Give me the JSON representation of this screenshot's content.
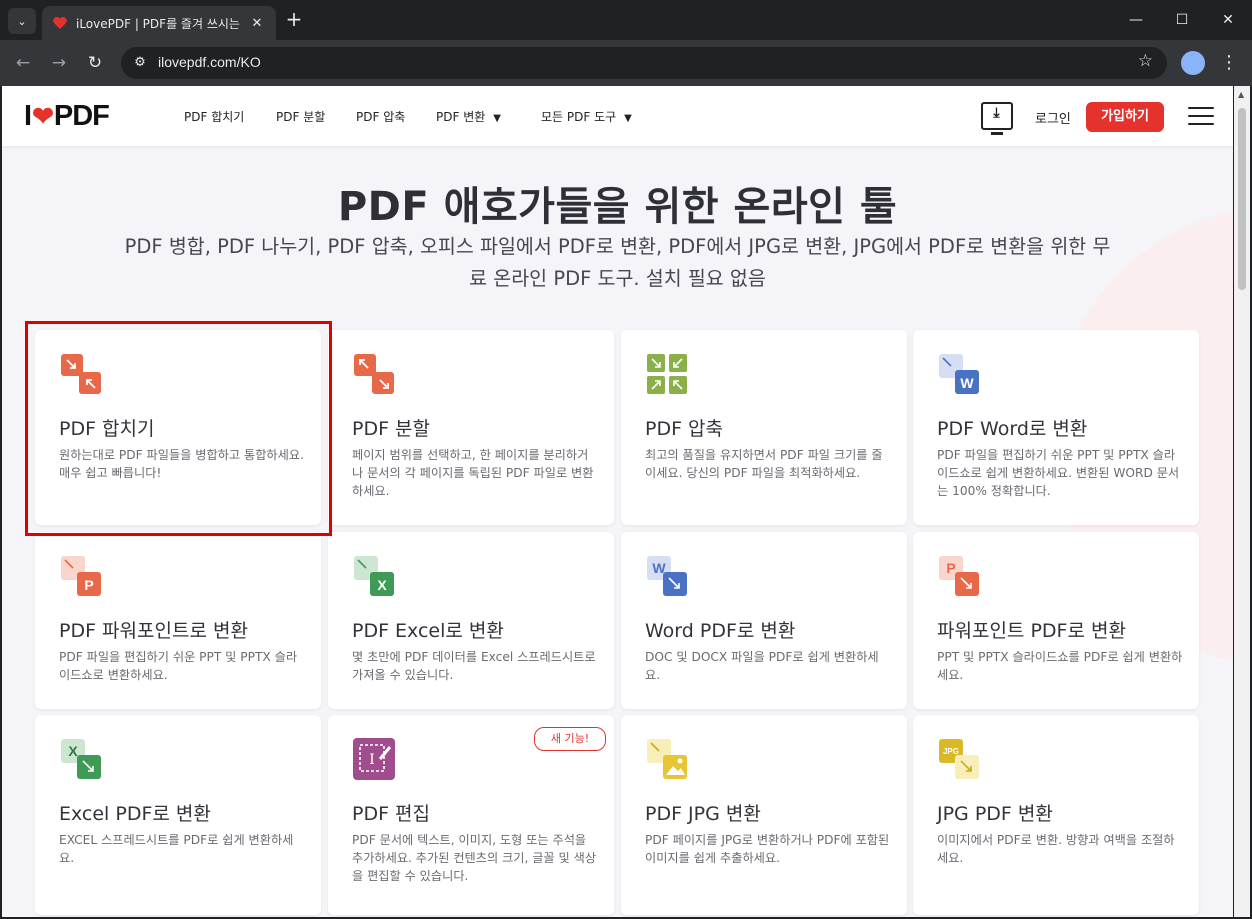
{
  "browser": {
    "tab_title": "iLovePDF | PDF를 즐겨 쓰시는",
    "url": "ilovepdf.com/KO"
  },
  "header": {
    "logo_left": "I",
    "logo_right": "PDF",
    "nav": [
      {
        "label": "PDF 합치기"
      },
      {
        "label": "PDF 분할"
      },
      {
        "label": "PDF 압축"
      },
      {
        "label": "PDF 변환",
        "has_dropdown": true
      },
      {
        "label": "모든 PDF 도구",
        "has_dropdown": true
      }
    ],
    "login": "로그인",
    "signup": "가입하기"
  },
  "hero": {
    "title": "PDF 애호가들을 위한 온라인 툴",
    "subtitle": "PDF 병합, PDF 나누기, PDF 압축, 오피스 파일에서 PDF로 변환, PDF에서 JPG로 변환, JPG에서 PDF로 변환을 위한 무료 온라인 PDF 도구. 설치 필요 없음"
  },
  "tools": [
    {
      "title": "PDF 합치기",
      "desc": "원하는대로 PDF 파일들을 병합하고 통합하세요. 매우 쉽고 빠릅니다!",
      "icon": "merge-icon"
    },
    {
      "title": "PDF 분할",
      "desc": "페이지 범위를 선택하고, 한 페이지를 분리하거나 문서의 각 페이지를 독립된 PDF 파일로 변환하세요.",
      "icon": "split-icon"
    },
    {
      "title": "PDF 압축",
      "desc": "최고의 품질을 유지하면서 PDF 파일 크기를 줄이세요. 당신의 PDF 파일을 최적화하세요.",
      "icon": "compress-icon"
    },
    {
      "title": "PDF Word로 변환",
      "desc": "PDF 파일을 편집하기 쉬운 PPT 및 PPTX 슬라이드쇼로 쉽게 변환하세요. 변환된 WORD 문서는 100% 정확합니다.",
      "icon": "word-icon",
      "letter": "W"
    },
    {
      "title": "PDF 파워포인트로 변환",
      "desc": "PDF 파일을 편집하기 쉬운 PPT 및 PPTX 슬라이드쇼로 변환하세요.",
      "icon": "powerpoint-icon",
      "letter": "P"
    },
    {
      "title": "PDF Excel로 변환",
      "desc": "몇 초만에 PDF 데이터를 Excel 스프레드시트로 가져올 수 있습니다.",
      "icon": "excel-icon",
      "letter": "X"
    },
    {
      "title": "Word PDF로 변환",
      "desc": "DOC 및 DOCX 파일을 PDF로 쉽게 변환하세요.",
      "icon": "word-icon",
      "letter": "W"
    },
    {
      "title": "파워포인트 PDF로 변환",
      "desc": "PPT 및 PPTX 슬라이드쇼를 PDF로 쉽게 변환하세요.",
      "icon": "powerpoint-icon",
      "letter": "P"
    },
    {
      "title": "Excel PDF로 변환",
      "desc": "EXCEL 스프레드시트를 PDF로 쉽게 변환하세요.",
      "icon": "excel-icon",
      "letter": "X"
    },
    {
      "title": "PDF 편집",
      "desc": "PDF 문서에 텍스트, 이미지, 도형 또는 주석을 추가하세요. 추가된 컨텐츠의 크기, 글꼴 및 색상을 편집할 수 있습니다.",
      "icon": "edit-icon",
      "badge": "새 기능!"
    },
    {
      "title": "PDF JPG 변환",
      "desc": "PDF 페이지를 JPG로 변환하거나 PDF에 포함된 이미지를 쉽게 추출하세요.",
      "icon": "image-icon"
    },
    {
      "title": "JPG PDF 변환",
      "desc": "이미지에서 PDF로 변환. 방향과 여백을 조절하세요.",
      "icon": "jpg-icon",
      "letter": "JPG"
    }
  ],
  "colors": {
    "brand_red": "#e5322d",
    "merge": "#e8684a",
    "compress": "#8ab04a",
    "word": "#4a72c4",
    "powerpoint": "#e8684a",
    "excel": "#3f9a55",
    "edit": "#a04d8e",
    "jpg": "#e8c631"
  }
}
